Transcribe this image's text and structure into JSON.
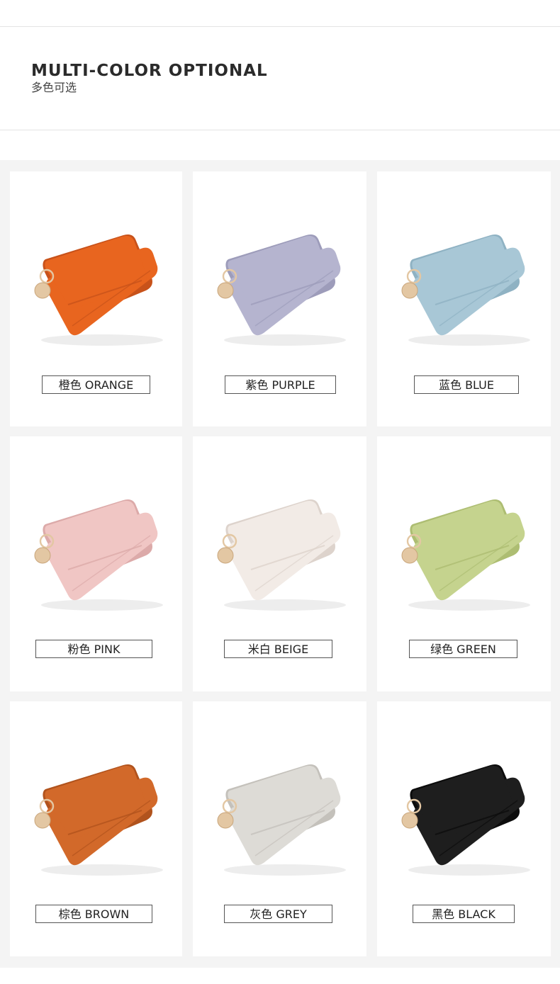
{
  "header": {
    "title": "MULTI-COLOR OPTIONAL",
    "subtitle": "多色可选"
  },
  "colors": [
    {
      "label": "橙色 ORANGE",
      "color": "#e8651f",
      "shade": "#c8521a",
      "icon": "wallet-icon"
    },
    {
      "label": "紫色 PURPLE",
      "color": "#b5b4cf",
      "shade": "#9d9cba",
      "icon": "wallet-icon"
    },
    {
      "label": "蓝色 BLUE",
      "color": "#a8c7d6",
      "shade": "#8fb2c3",
      "icon": "wallet-icon"
    },
    {
      "label": "粉色 PINK",
      "color": "#f0c6c4",
      "shade": "#dcaaa9",
      "icon": "wallet-icon"
    },
    {
      "label": "米白 BEIGE",
      "color": "#f2ebe6",
      "shade": "#ddd3cc",
      "icon": "wallet-icon"
    },
    {
      "label": "绿色 GREEN",
      "color": "#c5d38e",
      "shade": "#adbd72",
      "icon": "wallet-icon"
    },
    {
      "label": "棕色 BROWN",
      "color": "#d2692a",
      "shade": "#b1531d",
      "icon": "wallet-icon"
    },
    {
      "label": "灰色 GREY",
      "color": "#dddbd6",
      "shade": "#c4c1bb",
      "icon": "wallet-icon"
    },
    {
      "label": "黑色 BLACK",
      "color": "#1e1e1e",
      "shade": "#0c0c0c",
      "icon": "wallet-icon"
    }
  ],
  "ring_color": "#e3c7a3"
}
